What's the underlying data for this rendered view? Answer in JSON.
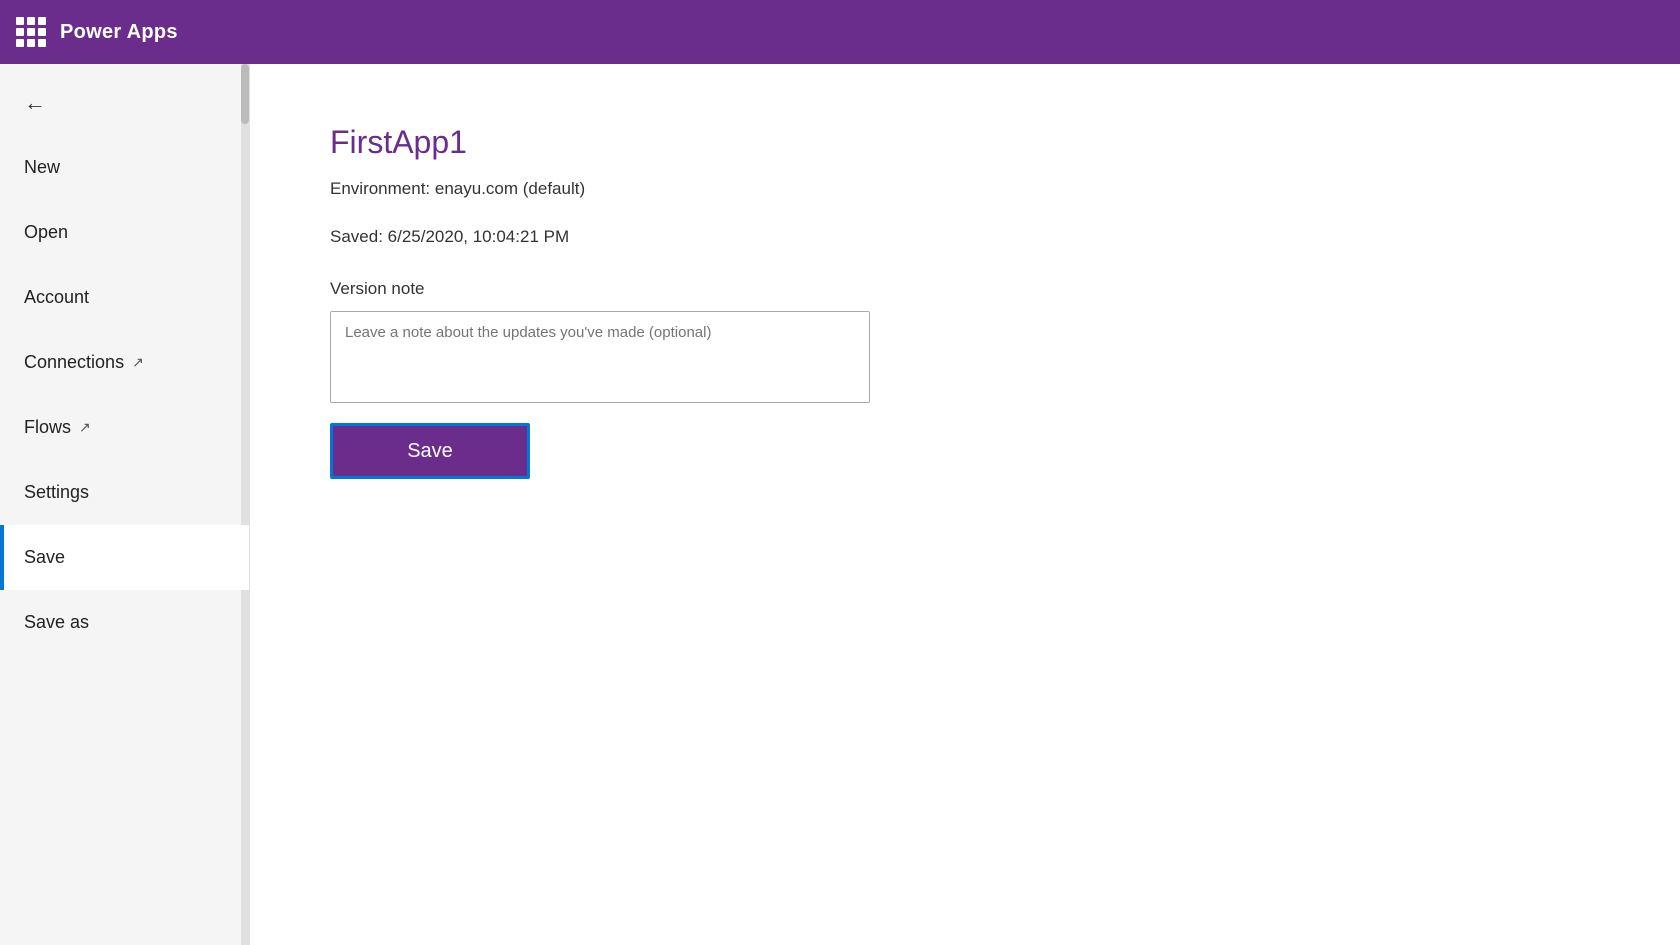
{
  "topbar": {
    "title": "Power Apps"
  },
  "sidebar": {
    "back_label": "←",
    "items": [
      {
        "id": "new",
        "label": "New",
        "active": false,
        "external": false
      },
      {
        "id": "open",
        "label": "Open",
        "active": false,
        "external": false
      },
      {
        "id": "account",
        "label": "Account",
        "active": false,
        "external": false
      },
      {
        "id": "connections",
        "label": "Connections",
        "active": false,
        "external": true
      },
      {
        "id": "flows",
        "label": "Flows",
        "active": false,
        "external": true
      },
      {
        "id": "settings",
        "label": "Settings",
        "active": false,
        "external": false
      },
      {
        "id": "save",
        "label": "Save",
        "active": true,
        "external": false
      },
      {
        "id": "save-as",
        "label": "Save as",
        "active": false,
        "external": false
      }
    ]
  },
  "content": {
    "app_name": "FirstApp1",
    "environment": "Environment: enayu.com (default)",
    "saved": "Saved: 6/25/2020, 10:04:21 PM",
    "version_note_label": "Version note",
    "version_note_placeholder": "Leave a note about the updates you've made (optional)",
    "save_button_label": "Save"
  }
}
